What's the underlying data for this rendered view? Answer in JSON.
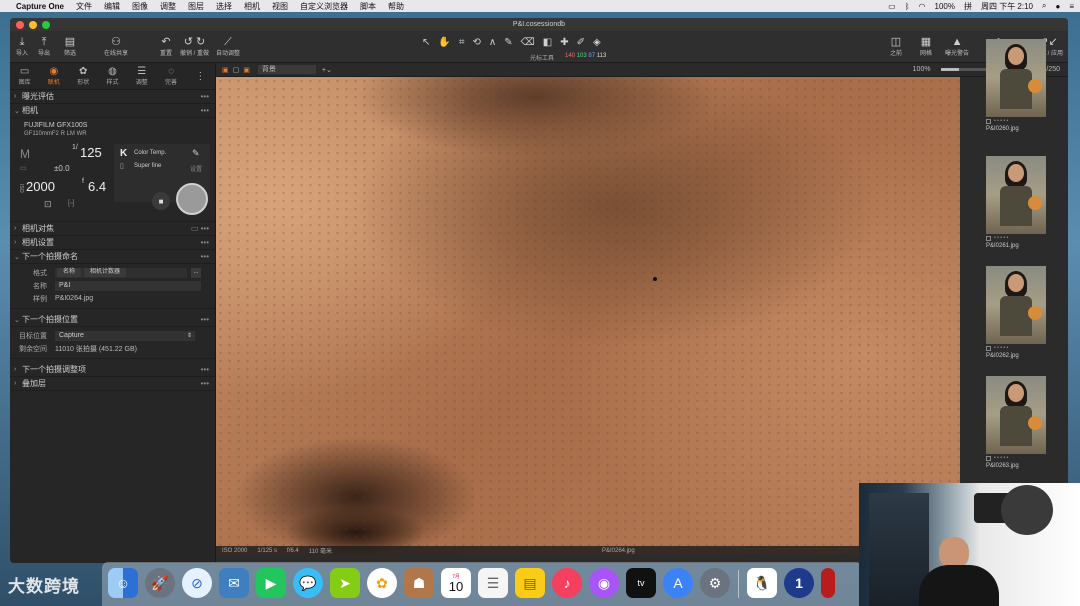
{
  "menubar": {
    "apple": "",
    "items": [
      "Capture One",
      "文件",
      "编辑",
      "图像",
      "调整",
      "图层",
      "选择",
      "相机",
      "视图",
      "自定义浏览器",
      "脚本",
      "帮助"
    ],
    "battery": "100%",
    "datetime": "周四 下午 2:10"
  },
  "window": {
    "title": "P&I.cosessiondb",
    "colors": {
      "close": "#ff5f57",
      "minimize": "#febc2e",
      "zoom": "#28c840",
      "accent": "#e87d2b"
    }
  },
  "toolbar": {
    "left": [
      {
        "icon": "import-icon",
        "label": "导入"
      },
      {
        "icon": "export-icon",
        "label": "导出"
      },
      {
        "icon": "filter-icon",
        "label": "筛选"
      },
      {
        "icon": "share-icon",
        "label": "在线共享"
      }
    ],
    "undo": {
      "label1": "重置",
      "label2": "撤销 / 重做"
    },
    "auto_adjust": "自动调整",
    "cursor_tools": "光标工具",
    "rgb": {
      "r": "140",
      "g": "103",
      "b": "87",
      "l": "113"
    },
    "right": [
      {
        "icon": "compare-icon",
        "label": "之前"
      },
      {
        "icon": "grid-icon",
        "label": "网格"
      },
      {
        "icon": "warning-icon",
        "label": "曝光警告"
      },
      {
        "icon": "learn-icon",
        "label": "学习"
      },
      {
        "icon": "copy-apply-icon",
        "label": "复制 / 应用"
      }
    ]
  },
  "subbar": {
    "view_mode": "背景",
    "zoom": "100%",
    "count": "1/250"
  },
  "left_panel": {
    "tabs": [
      {
        "icon": "library-icon",
        "label": "图库"
      },
      {
        "icon": "camera-icon",
        "label": "联机",
        "active": true
      },
      {
        "icon": "shape-icon",
        "label": "形状"
      },
      {
        "icon": "style-icon",
        "label": "样式"
      },
      {
        "icon": "adjust-icon",
        "label": "调整"
      },
      {
        "icon": "complete-icon",
        "label": "完善"
      }
    ],
    "sections": {
      "exposure": "曝光评估",
      "camera": "相机",
      "camera_focus": "相机对焦",
      "camera_settings": "相机设置",
      "next_naming": "下一个拍摄命名",
      "next_location": "下一个拍摄位置",
      "next_adjust": "下一个拍摄调整项",
      "overlay": "叠加层"
    },
    "camera": {
      "model": "FUJIFILM GFX100S",
      "lens": "GF110mmF2 R LM WR",
      "mode": "M",
      "shutter_prefix": "1/",
      "shutter": "125",
      "ev": "±0.0",
      "iso_label": "ISO",
      "iso": "2000",
      "aperture_prefix": "f",
      "aperture": "6.4",
      "wb_letter": "K",
      "wb_label": "Color Temp.",
      "quality": "Super fine",
      "settings_label": "设置"
    },
    "naming": {
      "format_label": "格式",
      "chip1": "名称",
      "chip2": "相机计数器",
      "name_label": "名称",
      "name_value": "P&I",
      "sample_label": "样例",
      "sample_value": "P&I0264.jpg"
    },
    "location": {
      "target_label": "目标位置",
      "target_value": "Capture",
      "remaining_label": "剩余空间",
      "remaining_value": "11010 张拍摄 (451.22 GB)"
    }
  },
  "viewer": {
    "status": [
      "ISO 2000",
      "1/125 s",
      "f/6.4",
      "110 毫米"
    ],
    "filename": "P&I0264.jpg"
  },
  "browser": {
    "items": [
      {
        "name": "P&I0260.jpg"
      },
      {
        "name": "P&I0261.jpg"
      },
      {
        "name": "P&I0262.jpg"
      },
      {
        "name": "P&I0263.jpg"
      }
    ]
  },
  "dock": {
    "apps": [
      {
        "icon": "finder-icon",
        "color": "#3b82f6"
      },
      {
        "icon": "launchpad-icon",
        "color": "#6b7280"
      },
      {
        "icon": "safari-icon",
        "color": "#2563eb"
      },
      {
        "icon": "mail-stamp-icon",
        "color": "#3f7fbf"
      },
      {
        "icon": "facetime-icon",
        "color": "#22c55e"
      },
      {
        "icon": "messages-icon",
        "color": "#38bdf8"
      },
      {
        "icon": "maps-icon",
        "color": "#65a30d"
      },
      {
        "icon": "photos-icon",
        "color": "#f5f5f5"
      },
      {
        "icon": "contacts-icon",
        "color": "#b0784a"
      },
      {
        "icon": "calendar-icon",
        "color": "#ffffff"
      },
      {
        "icon": "reminders-icon",
        "color": "#f5f5f5"
      },
      {
        "icon": "notes-icon",
        "color": "#facc15"
      },
      {
        "icon": "music-icon",
        "color": "#f43f5e"
      },
      {
        "icon": "podcasts-icon",
        "color": "#a855f7"
      },
      {
        "icon": "tv-icon",
        "color": "#111111"
      },
      {
        "icon": "appstore-icon",
        "color": "#3b82f6"
      },
      {
        "icon": "system-prefs-icon",
        "color": "#6b7280"
      },
      {
        "icon": "qq-icon",
        "color": "#ffffff"
      },
      {
        "icon": "1password-icon",
        "color": "#1e3a8a"
      }
    ],
    "calendar_month": "7月",
    "calendar_day": "10",
    "tv_label": "tv"
  },
  "watermark": "大数跨境"
}
